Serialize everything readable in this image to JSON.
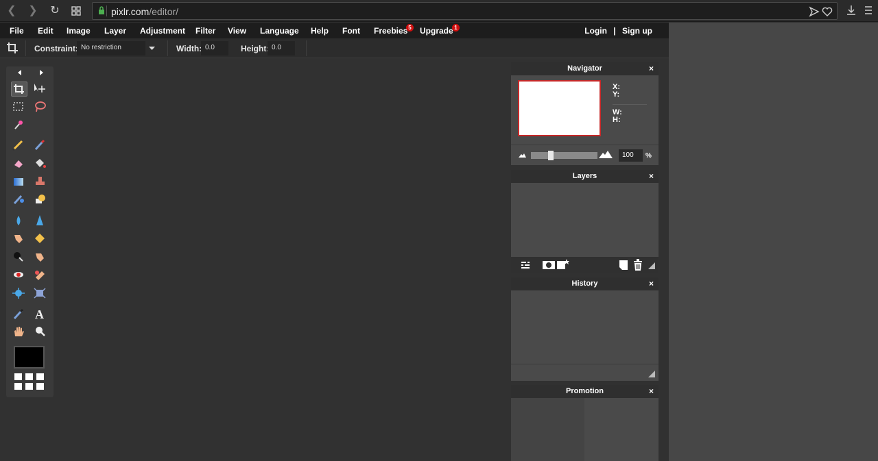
{
  "browser": {
    "url_domain": "pixlr.com",
    "url_path": "/editor/"
  },
  "menu": {
    "items": [
      "File",
      "Edit",
      "Image",
      "Layer",
      "Adjustment",
      "Filter",
      "View",
      "Language",
      "Help",
      "Font",
      "Freebies",
      "Upgrade"
    ],
    "freebies_badge": "5",
    "upgrade_badge": "1",
    "login": "Login",
    "separator": "|",
    "signup": "Sign up"
  },
  "options": {
    "constraint_label": "Constraint:",
    "constraint_value": "No restriction",
    "width_label": "Width:",
    "width_value": "0.0",
    "height_label": "Height:",
    "height_value": "0.0"
  },
  "toolbox": {
    "tools": [
      "crop",
      "move",
      "marquee",
      "lasso",
      "wand",
      "pencil",
      "brush",
      "eraser",
      "bucket",
      "gradient",
      "clone-stamp",
      "color-replace",
      "drawing",
      "blur",
      "sharpen",
      "smudge",
      "sponge",
      "dodge",
      "burn",
      "red-eye",
      "spot-heal",
      "bloat",
      "pinch",
      "color-picker",
      "type",
      "hand",
      "zoom"
    ]
  },
  "panels": {
    "navigator": {
      "title": "Navigator",
      "x_label": "X:",
      "y_label": "Y:",
      "w_label": "W:",
      "h_label": "H:",
      "zoom_value": "100",
      "zoom_unit": "%",
      "zoom_fraction": 0.28
    },
    "layers": {
      "title": "Layers"
    },
    "history": {
      "title": "History"
    },
    "promotion": {
      "title": "Promotion"
    },
    "close_glyph": "×"
  },
  "colors": {
    "accent_red": "#c62828",
    "badge_red": "#d10f0f",
    "lock_green": "#4caf50"
  }
}
